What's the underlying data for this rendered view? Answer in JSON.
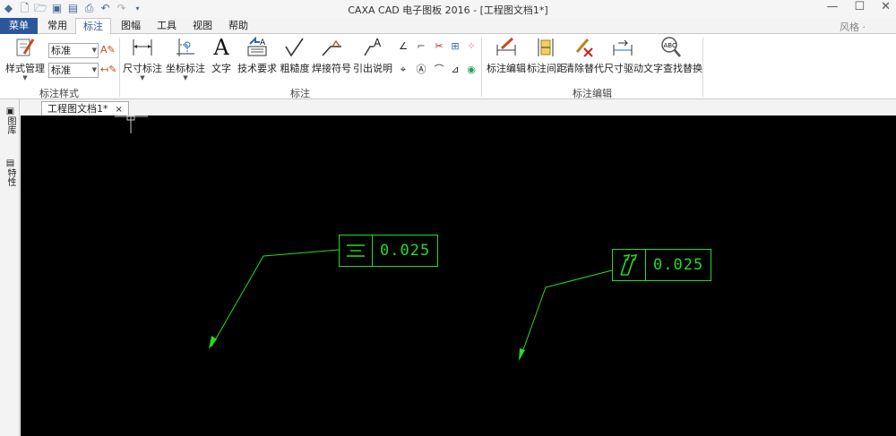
{
  "window": {
    "title": "CAXA CAD 电子图板 2016 - [工程图文档1*]",
    "style_label": "风格 ·",
    "controls": [
      "—",
      "☐",
      "✕"
    ]
  },
  "quick_access": [
    "logo-icon",
    "new-icon",
    "open-icon",
    "save-icon",
    "saveas-icon",
    "print-icon",
    "undo-icon",
    "redo-icon",
    "customize-icon"
  ],
  "tabs": [
    {
      "label": "菜单"
    },
    {
      "label": "常用"
    },
    {
      "label": "标注"
    },
    {
      "label": "图幅"
    },
    {
      "label": "工具"
    },
    {
      "label": "视图"
    },
    {
      "label": "帮助"
    }
  ],
  "ribbon": {
    "style_group": {
      "label": "标注样式",
      "style_manager": "样式管理",
      "combo1": "标准",
      "combo2": "标准"
    },
    "dim_group": {
      "label": "标注",
      "buttons": [
        "尺寸标注",
        "坐标标注",
        "文字",
        "技术要求",
        "粗糙度",
        "焊接符号",
        "引出说明"
      ],
      "text_glyph": "A"
    },
    "edit_group": {
      "label": "标注编辑",
      "buttons": [
        "标注编辑",
        "标注间距",
        "清除替代",
        "尺寸驱动",
        "文字查找替换"
      ],
      "abc_glyph": "ABC"
    }
  },
  "document": {
    "tab_label": "工程图文档1*",
    "close": "×",
    "side_panels": [
      "图库",
      "特性"
    ]
  },
  "drawing": {
    "frame1": {
      "symbol": "symmetry",
      "value": "0.025"
    },
    "frame2": {
      "symbol": "total-runout",
      "value": "0.025"
    },
    "color": "#22dd22"
  }
}
